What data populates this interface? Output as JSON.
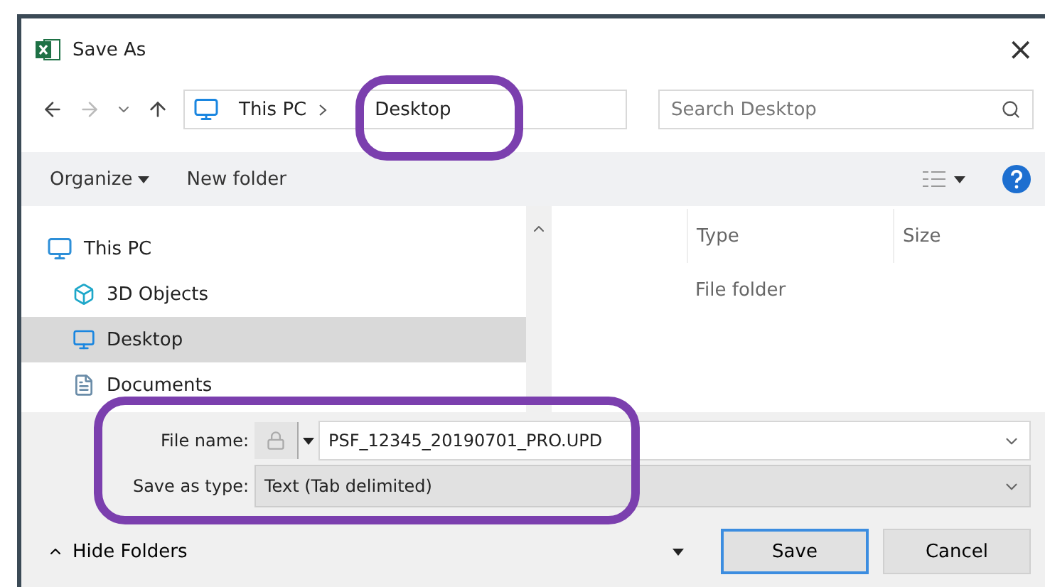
{
  "window": {
    "title": "Save As",
    "close": "×"
  },
  "address": {
    "breadcrumb": [
      "This PC",
      "Desktop"
    ],
    "search_placeholder": "Search Desktop"
  },
  "toolbar": {
    "organize": "Organize",
    "new_folder": "New folder"
  },
  "nav": [
    {
      "label": "This PC",
      "kind": "pc",
      "selected": false,
      "children": [
        {
          "label": "3D Objects",
          "kind": "objects",
          "selected": false
        },
        {
          "label": "Desktop",
          "kind": "desktop",
          "selected": true
        },
        {
          "label": "Documents",
          "kind": "documents",
          "selected": false
        }
      ]
    }
  ],
  "columns": [
    "Type",
    "Size"
  ],
  "rows": [
    {
      "type": "File folder"
    }
  ],
  "file_name": {
    "label": "File name:",
    "value": "PSF_12345_20190701_PRO.UPD"
  },
  "save_type": {
    "label": "Save as type:",
    "value": "Text (Tab delimited)"
  },
  "footer": {
    "hide_folders": "Hide Folders",
    "save": "Save",
    "cancel": "Cancel"
  }
}
